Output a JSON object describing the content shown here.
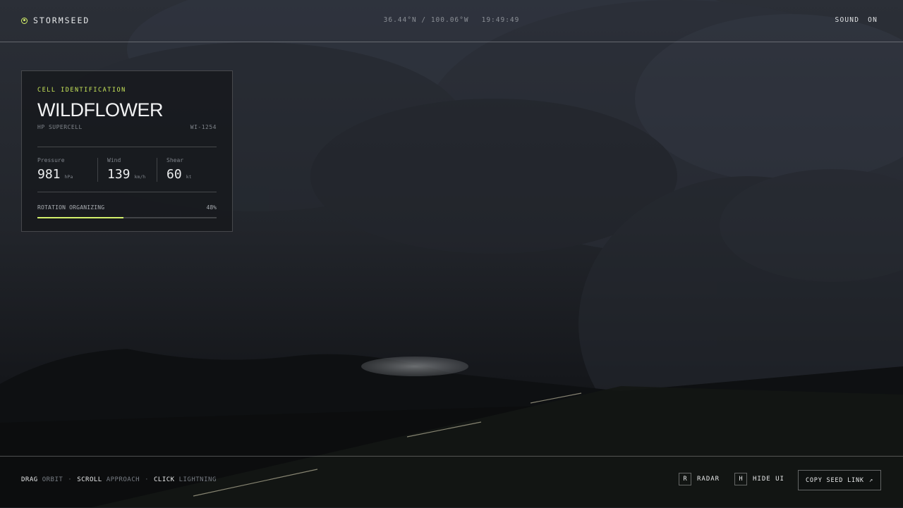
{
  "header": {
    "brand": "STORMSEED",
    "coords": "36.44°N / 100.06°W",
    "time": "19:49:49",
    "sound_label": "SOUND",
    "sound_state": "ON"
  },
  "cell": {
    "kicker": "CELL IDENTIFICATION",
    "name": "WILDFLOWER",
    "type": "HP SUPERCELL",
    "id": "WI-1254",
    "stats": [
      {
        "label": "Pressure",
        "value": "981",
        "unit": "hPa"
      },
      {
        "label": "Wind",
        "value": "139",
        "unit": "km/h"
      },
      {
        "label": "Shear",
        "value": "60",
        "unit": "kt"
      }
    ],
    "rotation_label": "ROTATION ORGANIZING",
    "rotation_text": "48%",
    "rotation_value": 48,
    "accent_color": "#d3f06c"
  },
  "footer": {
    "hints": [
      {
        "key": "DRAG",
        "action": "ORBIT"
      },
      {
        "key": "SCROLL",
        "action": "APPROACH"
      },
      {
        "key": "CLICK",
        "action": "LIGHTNING"
      }
    ],
    "hint_separator": "·",
    "radar_key": "R",
    "radar_label": "RADAR",
    "hide_key": "H",
    "hide_label": "HIDE UI",
    "copy_label": "COPY SEED LINK",
    "copy_icon": "↗"
  }
}
